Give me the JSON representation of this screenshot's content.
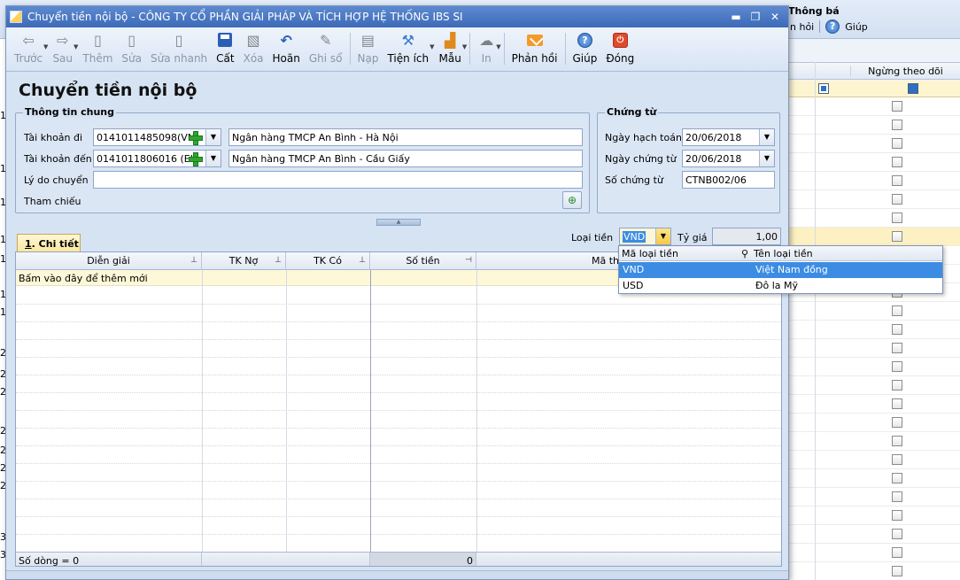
{
  "background": {
    "title": "Thông bá",
    "help_partial": "n hỏi",
    "help_label": "Giúp",
    "column_stop_tracking": "Ngừng theo dõi",
    "left_digits": [
      "1",
      "1",
      "1",
      "1",
      "1",
      "1",
      "1",
      "1",
      "2",
      "2",
      "2",
      "2",
      "2",
      "2",
      "2",
      "2",
      "3",
      "3"
    ]
  },
  "dialog": {
    "title": "Chuyển tiền nội bộ - CÔNG TY CỔ PHẦN GIẢI PHÁP VÀ TÍCH HỢP HỆ THỐNG IBS SI",
    "window_controls": [
      "▬",
      "❐",
      "✕"
    ]
  },
  "toolbar": {
    "prev": "Trước",
    "next": "Sau",
    "add": "Thêm",
    "edit": "Sửa",
    "quick_edit": "Sửa nhanh",
    "save": "Cất",
    "delete": "Xóa",
    "undo": "Hoãn",
    "post": "Ghi sổ",
    "load": "Nạp",
    "utilities": "Tiện ích",
    "template": "Mẫu",
    "print": "In",
    "feedback": "Phản hồi",
    "help": "Giúp",
    "close": "Đóng"
  },
  "page_title": "Chuyển tiền nội bộ",
  "general_info": {
    "group_title": "Thông tin chung",
    "from_account_label": "Tài khoản đi",
    "from_account_value": "0141011485098(VN",
    "from_bank": "Ngân hàng TMCP An Bình - Hà Nội",
    "to_account_label": "Tài khoản đến",
    "to_account_value": "0141011806016 (EL",
    "to_bank": "Ngân hàng TMCP An Bình - Cầu Giấy",
    "reason_label": "Lý do chuyển",
    "reason_value": "",
    "reference_label": "Tham chiếu"
  },
  "voucher": {
    "group_title": "Chứng từ",
    "posting_date_label": "Ngày hạch toán",
    "posting_date": "20/06/2018",
    "voucher_date_label": "Ngày chứng từ",
    "voucher_date": "20/06/2018",
    "voucher_no_label": "Số chứng từ",
    "voucher_no": "CTNB002/06"
  },
  "currency": {
    "label": "Loại tiền",
    "value": "VND",
    "rate_label": "Tỷ giá",
    "rate_value": "1,00"
  },
  "tab": {
    "hotkey": "1",
    "label": ". Chi tiết"
  },
  "detail_grid": {
    "columns": [
      "Diễn giải",
      "TK Nợ",
      "TK Có",
      "Số tiền",
      "Mã th"
    ],
    "new_row_hint": "Bấm vào đây để thêm mới",
    "footer_count": "Số dòng = 0",
    "footer_total": "0"
  },
  "currency_dropdown": {
    "col_code": "Mã loại tiền",
    "col_name": "Tên loại tiền",
    "rows": [
      {
        "code": "VND",
        "name": "Việt Nam đồng"
      },
      {
        "code": "USD",
        "name": "Đô la Mỹ"
      }
    ]
  }
}
